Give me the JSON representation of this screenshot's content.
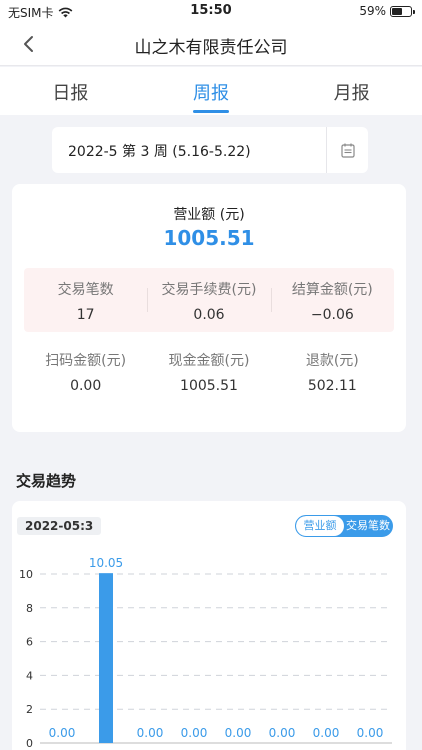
{
  "status": {
    "carrier": "无SIM卡",
    "time": "15:50",
    "battery": "59%",
    "battery_level": 0.59
  },
  "nav": {
    "title": "山之木有限责任公司"
  },
  "tabs": [
    {
      "label": "日报",
      "active": false
    },
    {
      "label": "周报",
      "active": true
    },
    {
      "label": "月报",
      "active": false
    }
  ],
  "date_picker": {
    "value": "2022-5 第 3 周 (5.16-5.22)"
  },
  "summary": {
    "revenue_label": "营业额 (元)",
    "revenue_value": "1005.51",
    "stats_top": [
      {
        "label": "交易笔数",
        "value": "17"
      },
      {
        "label": "交易手续费(元)",
        "value": "0.06"
      },
      {
        "label": "结算金额(元)",
        "value": "−0.06"
      }
    ],
    "stats_bottom": [
      {
        "label": "扫码金额(元)",
        "value": "0.00"
      },
      {
        "label": "现金金额(元)",
        "value": "1005.51"
      },
      {
        "label": "退款(元)",
        "value": "502.11"
      }
    ]
  },
  "trend": {
    "section_title": "交易趋势",
    "date_badge": "2022-05:3",
    "toggle": [
      "营业额",
      "交易笔数"
    ],
    "toggle_active": 0
  },
  "chart_data": {
    "type": "bar",
    "values": [
      0.0,
      10.05,
      0.0,
      0.0,
      0.0,
      0.0,
      0.0,
      0.0
    ],
    "value_labels": [
      "0.00",
      "10.05",
      "0.00",
      "0.00",
      "0.00",
      "0.00",
      "0.00",
      "0.00"
    ],
    "yticks": [
      "0",
      "2",
      "4",
      "6",
      "8",
      "10"
    ],
    "ylim": [
      0,
      10
    ],
    "grid": true,
    "color": "#3b9be9"
  },
  "colors": {
    "accent": "#2f8fe6",
    "pink_bg": "#fdf2f2"
  }
}
